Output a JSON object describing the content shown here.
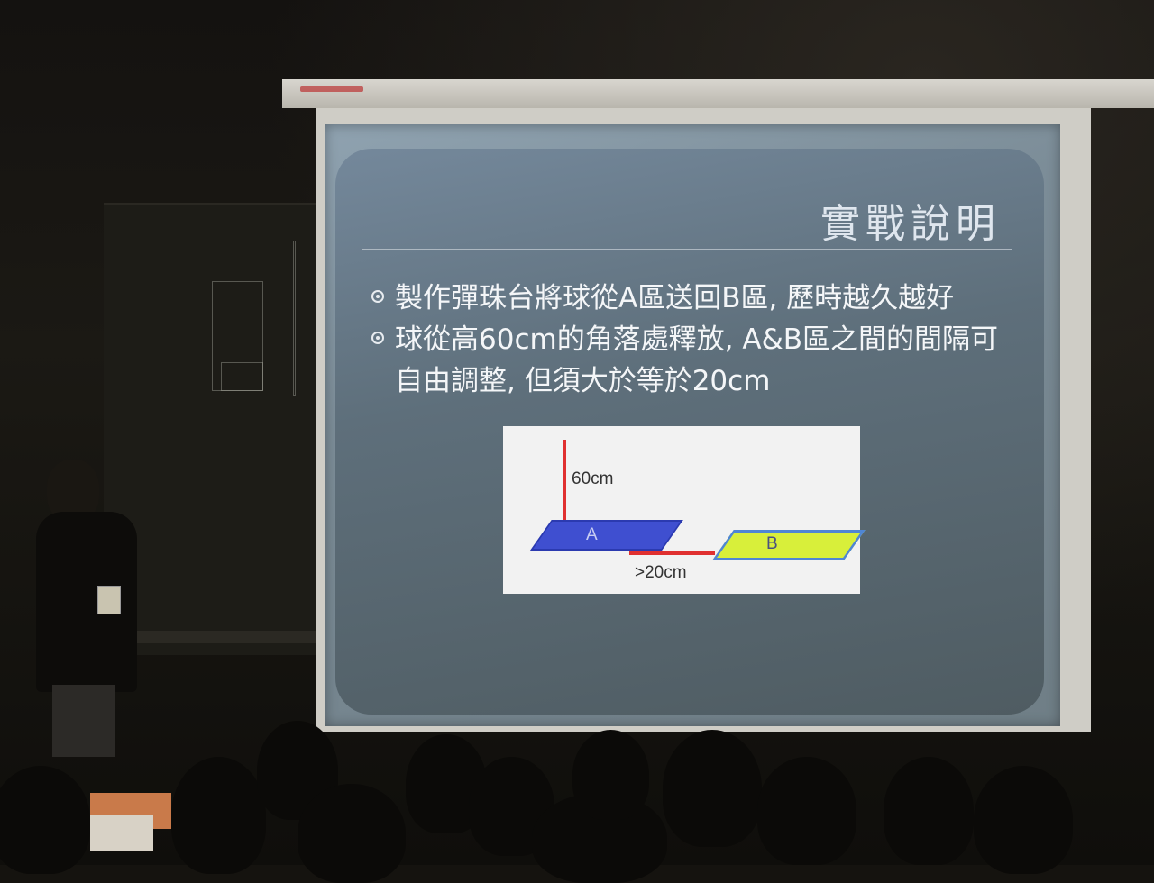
{
  "slide": {
    "title": "實戰說明",
    "bullets": [
      "製作彈珠台將球從A區送回B區, 歷時越久越好",
      "球從高60cm的角落處釋放, A&B區之間的間隔可自由調整, 但須大於等於20cm"
    ],
    "diagram": {
      "height_label": "60cm",
      "gap_label": ">20cm",
      "area_a_label": "A",
      "area_b_label": "B",
      "colors": {
        "line": "#e03030",
        "area_a": "#3f4fd0",
        "area_b": "#d8ef3a",
        "area_b_border": "#4f86d4"
      }
    }
  }
}
